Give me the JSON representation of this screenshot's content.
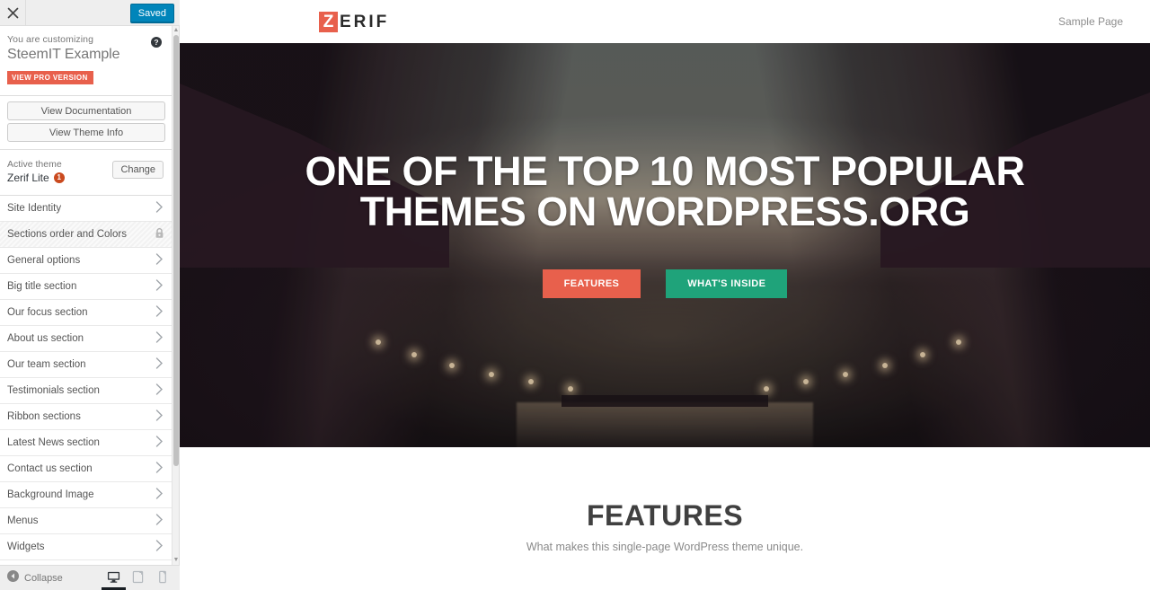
{
  "customizer": {
    "close_icon": "close-x-icon",
    "save_label": "Saved",
    "customizing_label": "You are customizing",
    "site_title": "SteemIT Example",
    "pro_badge": "VIEW PRO VERSION",
    "help_icon": "help-circle-icon",
    "buttons": [
      {
        "label": "View Documentation",
        "name": "view-documentation-button"
      },
      {
        "label": "View Theme Info",
        "name": "view-theme-info-button"
      }
    ],
    "active_theme": {
      "label": "Active theme",
      "name": "Zerif Lite",
      "update_count": "1",
      "change_label": "Change"
    },
    "panels": [
      {
        "label": "Site Identity",
        "control": "chevron-right-icon",
        "locked": false
      },
      {
        "label": "Sections order and Colors",
        "control": "lock-icon",
        "locked": true
      },
      {
        "label": "General options",
        "control": "chevron-right-icon",
        "locked": false
      },
      {
        "label": "Big title section",
        "control": "chevron-right-icon",
        "locked": false
      },
      {
        "label": "Our focus section",
        "control": "chevron-right-icon",
        "locked": false
      },
      {
        "label": "About us section",
        "control": "chevron-right-icon",
        "locked": false
      },
      {
        "label": "Our team section",
        "control": "chevron-right-icon",
        "locked": false
      },
      {
        "label": "Testimonials section",
        "control": "chevron-right-icon",
        "locked": false
      },
      {
        "label": "Ribbon sections",
        "control": "chevron-right-icon",
        "locked": false
      },
      {
        "label": "Latest News section",
        "control": "chevron-right-icon",
        "locked": false
      },
      {
        "label": "Contact us section",
        "control": "chevron-right-icon",
        "locked": false
      },
      {
        "label": "Background Image",
        "control": "chevron-right-icon",
        "locked": false
      },
      {
        "label": "Menus",
        "control": "chevron-right-icon",
        "locked": false
      },
      {
        "label": "Widgets",
        "control": "chevron-right-icon",
        "locked": false
      }
    ],
    "footer": {
      "collapse_label": "Collapse",
      "collapse_icon": "collapse-arrow-icon",
      "devices": [
        {
          "label": "Desktop",
          "icon": "desktop-icon",
          "active": true
        },
        {
          "label": "Tablet",
          "icon": "tablet-icon",
          "active": false
        },
        {
          "label": "Mobile",
          "icon": "mobile-icon",
          "active": false
        }
      ]
    },
    "scrollbar": {
      "up_arrow": "▲",
      "down_arrow": "▼"
    }
  },
  "preview": {
    "logo": {
      "mark": "Z",
      "rest": "ERIF"
    },
    "nav": [
      {
        "label": "Sample Page"
      }
    ],
    "hero": {
      "title_line1": "ONE OF THE TOP 10 MOST POPULAR",
      "title_line2": "THEMES ON WORDPRESS.ORG",
      "primary_button": "FEATURES",
      "secondary_button": "WHAT'S INSIDE"
    },
    "features": {
      "title": "FEATURES",
      "subtitle": "What makes this single-page WordPress theme unique."
    }
  },
  "colors": {
    "accent_red": "#e8604c",
    "accent_green": "#1fa37a",
    "save_blue": "#0085ba",
    "badge_orange": "#ca4a1f"
  }
}
